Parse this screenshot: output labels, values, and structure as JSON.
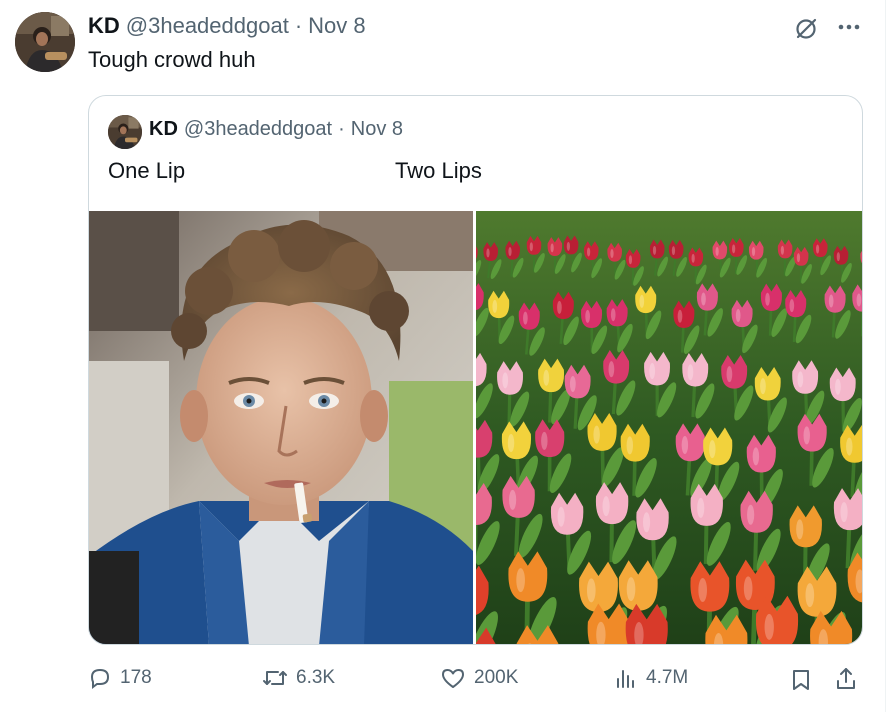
{
  "tweet": {
    "author_name": "KD",
    "author_handle": "@3headeddgoat",
    "separator": "·",
    "date": "Nov 8",
    "text": "Tough crowd huh"
  },
  "quoted_tweet": {
    "author_name": "KD",
    "author_handle": "@3headeddgoat",
    "separator": "·",
    "date": "Nov 8",
    "caption_left": "One Lip",
    "caption_right": "Two Lips"
  },
  "actions": {
    "replies": "178",
    "reposts": "6.3K",
    "likes": "200K",
    "views": "4.7M"
  },
  "icons": {
    "header": [
      "grok-icon",
      "more-icon"
    ],
    "actions": [
      "reply-icon",
      "repost-icon",
      "like-icon",
      "views-icon",
      "bookmark-icon",
      "share-icon"
    ]
  },
  "colors": {
    "text_primary": "#0f1419",
    "text_secondary": "#536471",
    "border": "#cfd9de"
  }
}
